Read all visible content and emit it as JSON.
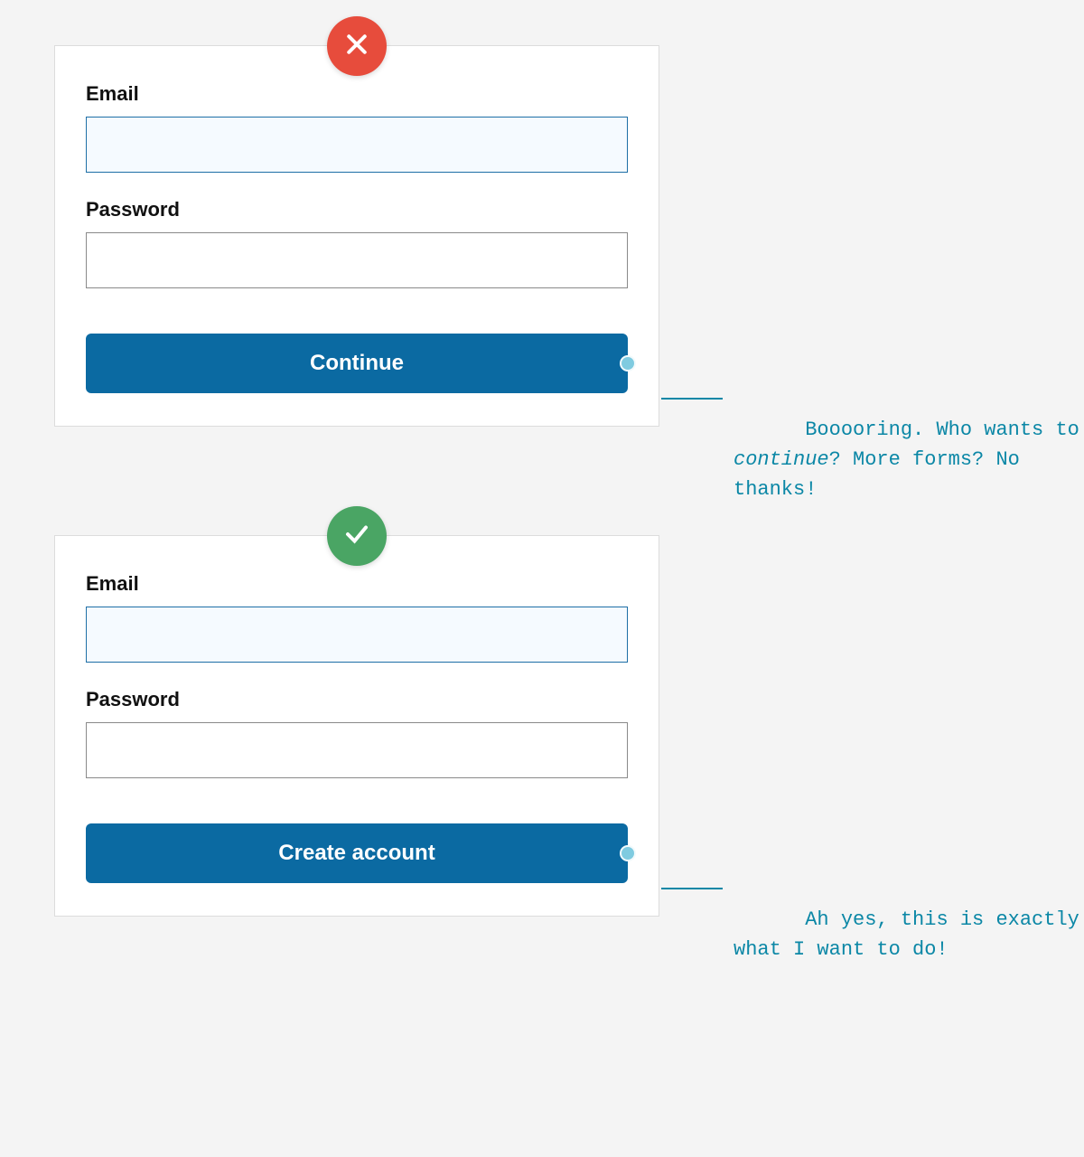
{
  "examples": [
    {
      "kind": "bad",
      "email_label": "Email",
      "password_label": "Password",
      "button_label": "Continue",
      "annotation_pre": "Booooring. Who wants to ",
      "annotation_em": "continue",
      "annotation_post": "? More forms? No thanks!"
    },
    {
      "kind": "good",
      "email_label": "Email",
      "password_label": "Password",
      "button_label": "Create account",
      "annotation_pre": "Ah yes, this is exactly what I want to do!",
      "annotation_em": "",
      "annotation_post": ""
    }
  ]
}
